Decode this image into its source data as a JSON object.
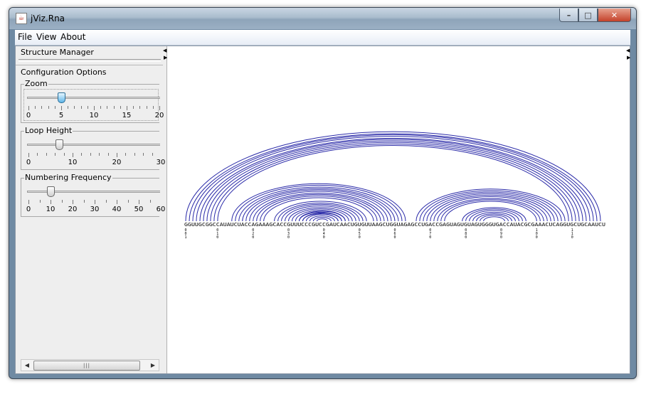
{
  "window": {
    "title": "jViz.Rna",
    "icon": "java-cup-icon",
    "controls": {
      "minimize": "–",
      "maximize": "□",
      "close": "✕"
    }
  },
  "menu": [
    "File",
    "View",
    "About"
  ],
  "left_panel": {
    "structure_manager": "Structure Manager",
    "configuration": {
      "title": "Configuration Options",
      "zoom": {
        "label": "Zoom",
        "value": 5,
        "tick_labels": [
          "0",
          "5",
          "10",
          "15",
          "20"
        ],
        "min": 0,
        "max": 20
      },
      "loop_height": {
        "label": "Loop Height",
        "value": 7,
        "tick_labels": [
          "0",
          "10",
          "20",
          "30"
        ],
        "min": 0,
        "max": 30
      },
      "numbering_frequency": {
        "label": "Numbering Frequency",
        "value": 10,
        "tick_labels": [
          "0",
          "10",
          "20",
          "30",
          "40",
          "50",
          "60"
        ],
        "min": 0,
        "max": 60
      }
    },
    "scrollbar": {
      "left": "◀",
      "right": "▶",
      "grip": "|||"
    }
  },
  "viewer": {
    "sequence": "GGUUGCGGCCAUAUCUACCAGAAAGCACCGUUUCCCGUCCGAUCAACUGUGUUAAGCUGGUAGAGCCUGACCGAGUAGUGUAGUGGGUGACCAUACGCGAAACUCAGGUGCUGCAAUCU",
    "numbering": [
      "1",
      "10",
      "20",
      "30",
      "40",
      "50",
      "60",
      "70",
      "80",
      "90",
      "100",
      "110"
    ],
    "arc_color": "#2a2aa8",
    "helices": [
      {
        "outer_i": 1,
        "outer_j": 118,
        "count": 10
      },
      {
        "outer_i": 14,
        "outer_j": 63,
        "count": 10
      },
      {
        "outer_i": 26,
        "outer_j": 52,
        "count": 9
      },
      {
        "outer_i": 33,
        "outer_j": 46,
        "count": 6
      },
      {
        "outer_i": 66,
        "outer_j": 108,
        "count": 9
      },
      {
        "outer_i": 79,
        "outer_j": 97,
        "count": 7
      }
    ]
  }
}
